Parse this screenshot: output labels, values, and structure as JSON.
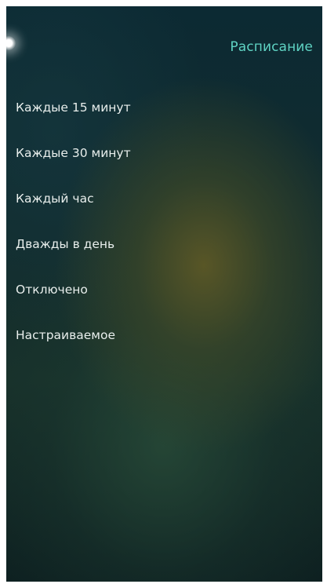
{
  "header": {
    "title": "Расписание"
  },
  "options": [
    {
      "label": "Каждые 15 минут"
    },
    {
      "label": "Каждые 30 минут"
    },
    {
      "label": "Каждый час"
    },
    {
      "label": "Дважды в день"
    },
    {
      "label": "Отключено"
    },
    {
      "label": "Настраиваемое"
    }
  ],
  "colors": {
    "accent": "#5fd3c3",
    "text": "#e8eeec",
    "background_dark": "#0c2a33",
    "background_warm": "#5c5826"
  }
}
